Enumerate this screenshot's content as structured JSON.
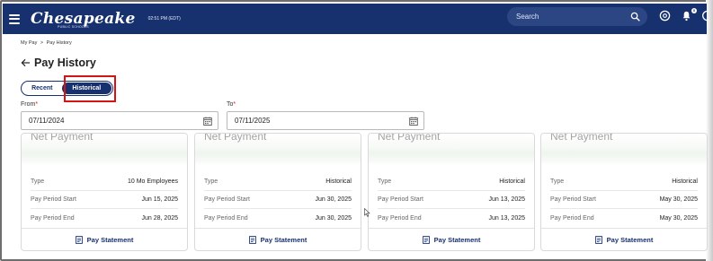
{
  "header": {
    "logo": "Chesapeake",
    "logo_sub": "PUBLIC SCHOOLS",
    "time": "02:51 PM (EDT)",
    "search_placeholder": "Search",
    "notification_count": "0",
    "brand_color": "#17306e"
  },
  "breadcrumb": {
    "items": [
      "My Pay",
      "Pay History"
    ],
    "separator": ">"
  },
  "page_title": "Pay History",
  "toggle": {
    "options": [
      "Recent",
      "Historical"
    ],
    "selected": "Historical"
  },
  "filters": {
    "from": {
      "label": "From",
      "required_mark": "*",
      "value": "07/11/2024"
    },
    "to": {
      "label": "To",
      "required_mark": "*",
      "value": "07/11/2025"
    }
  },
  "cards": [
    {
      "heading": "Net Payment",
      "type_label": "Type",
      "type": "10 Mo Employees",
      "start_label": "Pay Period Start",
      "start": "Jun 15, 2025",
      "end_label": "Pay Period End",
      "end": "Jun 28, 2025",
      "action": "Pay Statement"
    },
    {
      "heading": "Net Payment",
      "type_label": "Type",
      "type": "Historical",
      "start_label": "Pay Period Start",
      "start": "Jun 30, 2025",
      "end_label": "Pay Period End",
      "end": "Jun 30, 2025",
      "action": "Pay Statement"
    },
    {
      "heading": "Net Payment",
      "type_label": "Type",
      "type": "Historical",
      "start_label": "Pay Period Start",
      "start": "Jun 13, 2025",
      "end_label": "Pay Period End",
      "end": "Jun 13, 2025",
      "action": "Pay Statement"
    },
    {
      "heading": "Net Payment",
      "type_label": "Type",
      "type": "Historical",
      "start_label": "Pay Period Start",
      "start": "May 30, 2025",
      "end_label": "Pay Period End",
      "end": "May 30, 2025",
      "action": "Pay Statement"
    }
  ]
}
